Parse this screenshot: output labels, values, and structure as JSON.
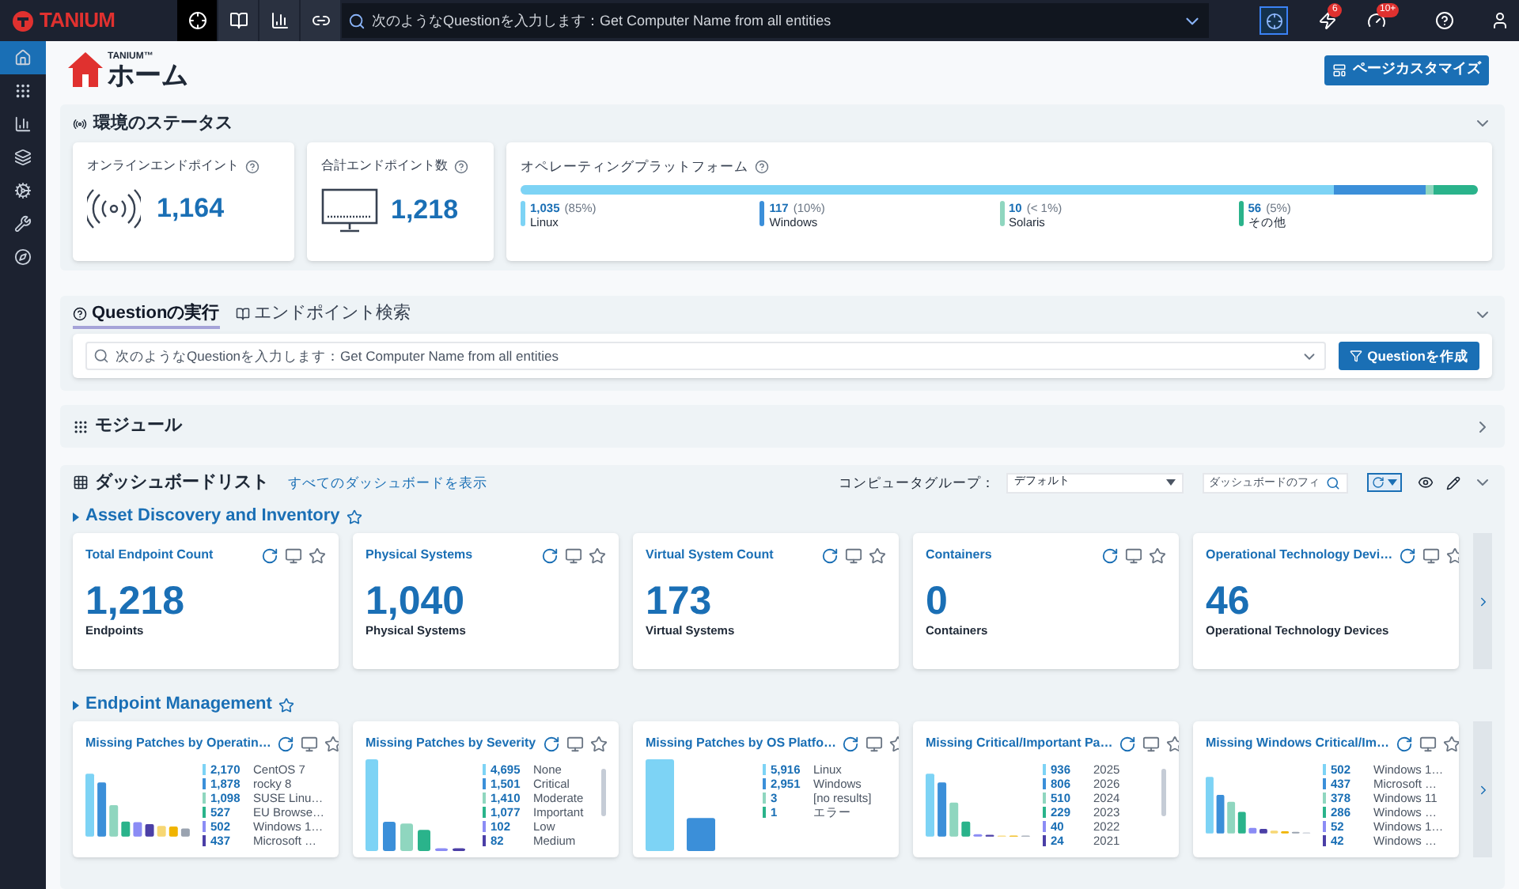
{
  "top_bar": {
    "logo": "TANIUM",
    "nav": [
      {
        "kind": "target",
        "selected": true
      },
      {
        "kind": "book",
        "selected": false
      },
      {
        "kind": "chart",
        "selected": false
      },
      {
        "kind": "link",
        "selected": false
      }
    ],
    "search": {
      "placeholder": "次のようなQuestionを入力します：Get Computer Name from all entities"
    },
    "alerts": "6",
    "notifications": "10+"
  },
  "sidebar": {
    "items": [
      {
        "kind": "home",
        "selected": true
      },
      {
        "kind": "grid",
        "selected": false
      },
      {
        "kind": "chart",
        "selected": false
      },
      {
        "kind": "layers",
        "selected": false
      },
      {
        "kind": "gears",
        "selected": false
      },
      {
        "kind": "tools",
        "selected": false
      },
      {
        "kind": "compass",
        "selected": false
      }
    ]
  },
  "header": {
    "brand": "TANIUM™",
    "title": "ホーム",
    "customize_button": "ページカスタマイズ"
  },
  "environment": {
    "title": "環境のステータス",
    "expanded": true,
    "online": {
      "label": "オンラインエンドポイント",
      "value": "1,164"
    },
    "total": {
      "label": "合計エンドポイント数",
      "value": "1,218"
    },
    "platform": {
      "label": "オペレーティングプラットフォーム",
      "segments": [
        {
          "count": "1,035",
          "percent": "(85%)",
          "name": "Linux",
          "level": 0.85,
          "color": "#7dd3f5"
        },
        {
          "count": "117",
          "percent": "(10%)",
          "name": "Windows",
          "color": "#3b8fd9"
        },
        {
          "count": "10",
          "percent": "(< 1%)",
          "name": "Solaris",
          "color": "#8fd6bf"
        },
        {
          "count": "56",
          "percent": "(5%)",
          "name": "その他",
          "level": 0.047,
          "color": "#2ab38b"
        }
      ]
    }
  },
  "question": {
    "tabs": [
      {
        "label": "Questionの実行",
        "selected": true
      },
      {
        "label": "エンドポイント検索",
        "selected": false
      }
    ],
    "placeholder": "次のようなQuestionを入力します：Get Computer Name from all entities",
    "button": "Questionを作成",
    "expanded": true
  },
  "modules": {
    "title": "モジュール",
    "expanded": false
  },
  "dashboards": {
    "title": "ダッシュボードリスト",
    "link": "すべてのダッシュボードを表示",
    "group_label": "コンピュータグループ：",
    "group_value": "デフォルト",
    "filter_placeholder": "ダッシュボードのフィ",
    "expanded": true,
    "sections": [
      {
        "title": "Asset Discovery and Inventory",
        "cards": [
          {
            "kind": "count",
            "title": "Total Endpoint Count",
            "value": "1,218",
            "caption": "Endpoints"
          },
          {
            "kind": "count",
            "title": "Physical Systems",
            "value": "1,040",
            "caption": "Physical Systems"
          },
          {
            "kind": "count",
            "title": "Virtual System Count",
            "value": "173",
            "caption": "Virtual Systems"
          },
          {
            "kind": "count",
            "title": "Containers",
            "value": "0",
            "caption": "Containers"
          },
          {
            "kind": "count",
            "title": "Operational Technology Devi…",
            "value": "46",
            "caption": "Operational Technology Devices"
          }
        ]
      },
      {
        "title": "Endpoint Management",
        "cards": [
          {
            "kind": "chart",
            "title": "Missing Patches by Operatin…",
            "legend": [
              {
                "value": "2,170",
                "label": "CentOS 7",
                "color": "#7dd3f5"
              },
              {
                "value": "1,878",
                "label": "rocky 8",
                "color": "#3b8fd9"
              },
              {
                "value": "1,098",
                "label": "SUSE Linu…",
                "color": "#8fd6bf"
              },
              {
                "value": "527",
                "label": "EU Browse…",
                "color": "#2ab38b"
              },
              {
                "value": "502",
                "label": "Windows 1…",
                "color": "#8b8cf5"
              },
              {
                "value": "437",
                "label": "Microsoft …",
                "color": "#4b3fa6"
              }
            ]
          },
          {
            "kind": "chart",
            "title": "Missing Patches by Severity",
            "legend": [
              {
                "value": "4,695",
                "label": "None",
                "color": "#7dd3f5"
              },
              {
                "value": "1,501",
                "label": "Critical",
                "color": "#3b8fd9"
              },
              {
                "value": "1,410",
                "label": "Moderate",
                "color": "#8fd6bf"
              },
              {
                "value": "1,077",
                "label": "Important",
                "color": "#2ab38b"
              },
              {
                "value": "102",
                "label": "Low",
                "color": "#8b8cf5"
              },
              {
                "value": "82",
                "label": "Medium",
                "color": "#4b3fa6"
              }
            ]
          },
          {
            "kind": "chart",
            "title": "Missing Patches by OS Platfo…",
            "legend": [
              {
                "value": "5,916",
                "label": "Linux",
                "color": "#7dd3f5"
              },
              {
                "value": "2,951",
                "label": "Windows",
                "color": "#3b8fd9"
              },
              {
                "value": "3",
                "label": "[no results]",
                "color": "#8fd6bf"
              },
              {
                "value": "1",
                "label": "エラー",
                "color": "#2ab38b"
              }
            ]
          },
          {
            "kind": "chart",
            "title": "Missing Critical/Important Pa…",
            "legend": [
              {
                "value": "936",
                "label": "2025",
                "color": "#7dd3f5"
              },
              {
                "value": "806",
                "label": "2026",
                "color": "#3b8fd9"
              },
              {
                "value": "510",
                "label": "2024",
                "color": "#8fd6bf"
              },
              {
                "value": "229",
                "label": "2023",
                "color": "#2ab38b"
              },
              {
                "value": "40",
                "label": "2022",
                "color": "#8b8cf5"
              },
              {
                "value": "24",
                "label": "2021",
                "color": "#4b3fa6"
              }
            ]
          },
          {
            "kind": "chart",
            "title": "Missing Windows Critical/Im…",
            "legend": [
              {
                "value": "502",
                "label": "Windows 1…",
                "color": "#7dd3f5"
              },
              {
                "value": "437",
                "label": "Microsoft …",
                "color": "#3b8fd9"
              },
              {
                "value": "378",
                "label": "Windows 11",
                "color": "#8fd6bf"
              },
              {
                "value": "286",
                "label": "Windows …",
                "color": "#2ab38b"
              },
              {
                "value": "52",
                "label": "Windows 1…",
                "color": "#8b8cf5"
              },
              {
                "value": "42",
                "label": "Windows …",
                "color": "#4b3fa6"
              }
            ]
          }
        ]
      }
    ]
  }
}
